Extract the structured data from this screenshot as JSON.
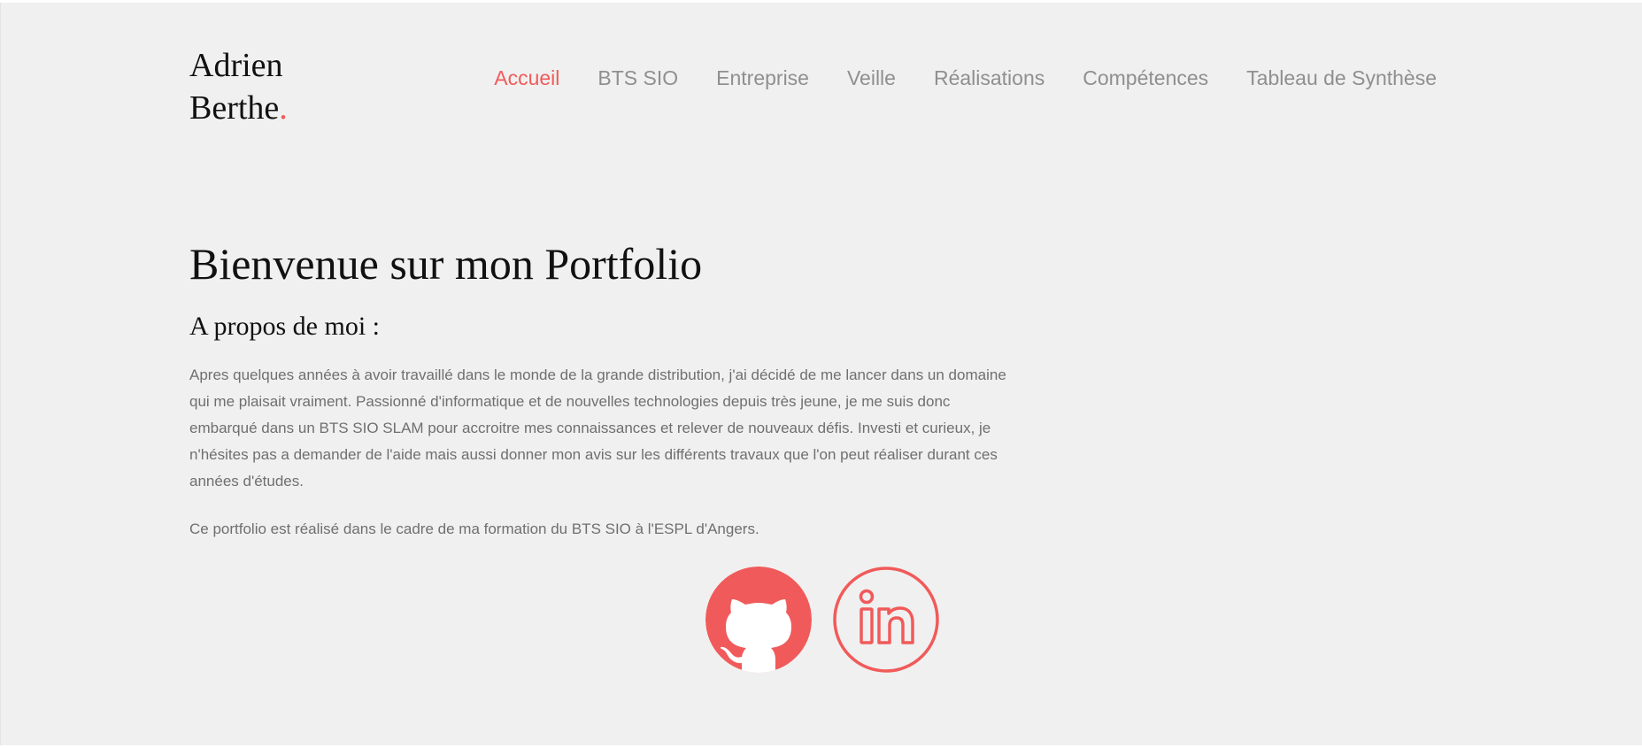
{
  "logo": {
    "line1": "Adrien",
    "line2": "Berthe",
    "dot": "."
  },
  "nav": {
    "items": [
      {
        "label": "Accueil",
        "active": true
      },
      {
        "label": "BTS SIO"
      },
      {
        "label": "Entreprise"
      },
      {
        "label": "Veille"
      },
      {
        "label": "Réalisations"
      },
      {
        "label": "Compétences"
      },
      {
        "label": "Tableau de Synthèse"
      }
    ]
  },
  "hero": {
    "title": "Bienvenue sur mon Portfolio"
  },
  "about": {
    "title": "A propos de moi :",
    "text": "Apres quelques années à avoir travaillé dans le monde de la grande distribution, j'ai décidé de me lancer dans un domaine qui me plaisait vraiment. Passionné d'informatique et de nouvelles technologies depuis très jeune, je me suis donc embarqué dans un BTS SIO SLAM pour accroitre mes connaissances et relever de nouveaux défis. Investi et curieux, je n'hésites pas a demander de l'aide mais aussi donner mon avis sur les différents travaux que l'on peut réaliser durant ces années d'études.",
    "note": "Ce portfolio est réalisé dans le cadre de ma formation du BTS SIO à l'ESPL d'Angers."
  },
  "socials": [
    {
      "icon": "github-icon"
    },
    {
      "icon": "linkedin-icon"
    }
  ],
  "colors": {
    "accent": "#f15a5a",
    "background": "#f0f0f0",
    "nav_text": "#8f8f8f",
    "body_text": "#6f6f6f",
    "heading": "#111111"
  }
}
